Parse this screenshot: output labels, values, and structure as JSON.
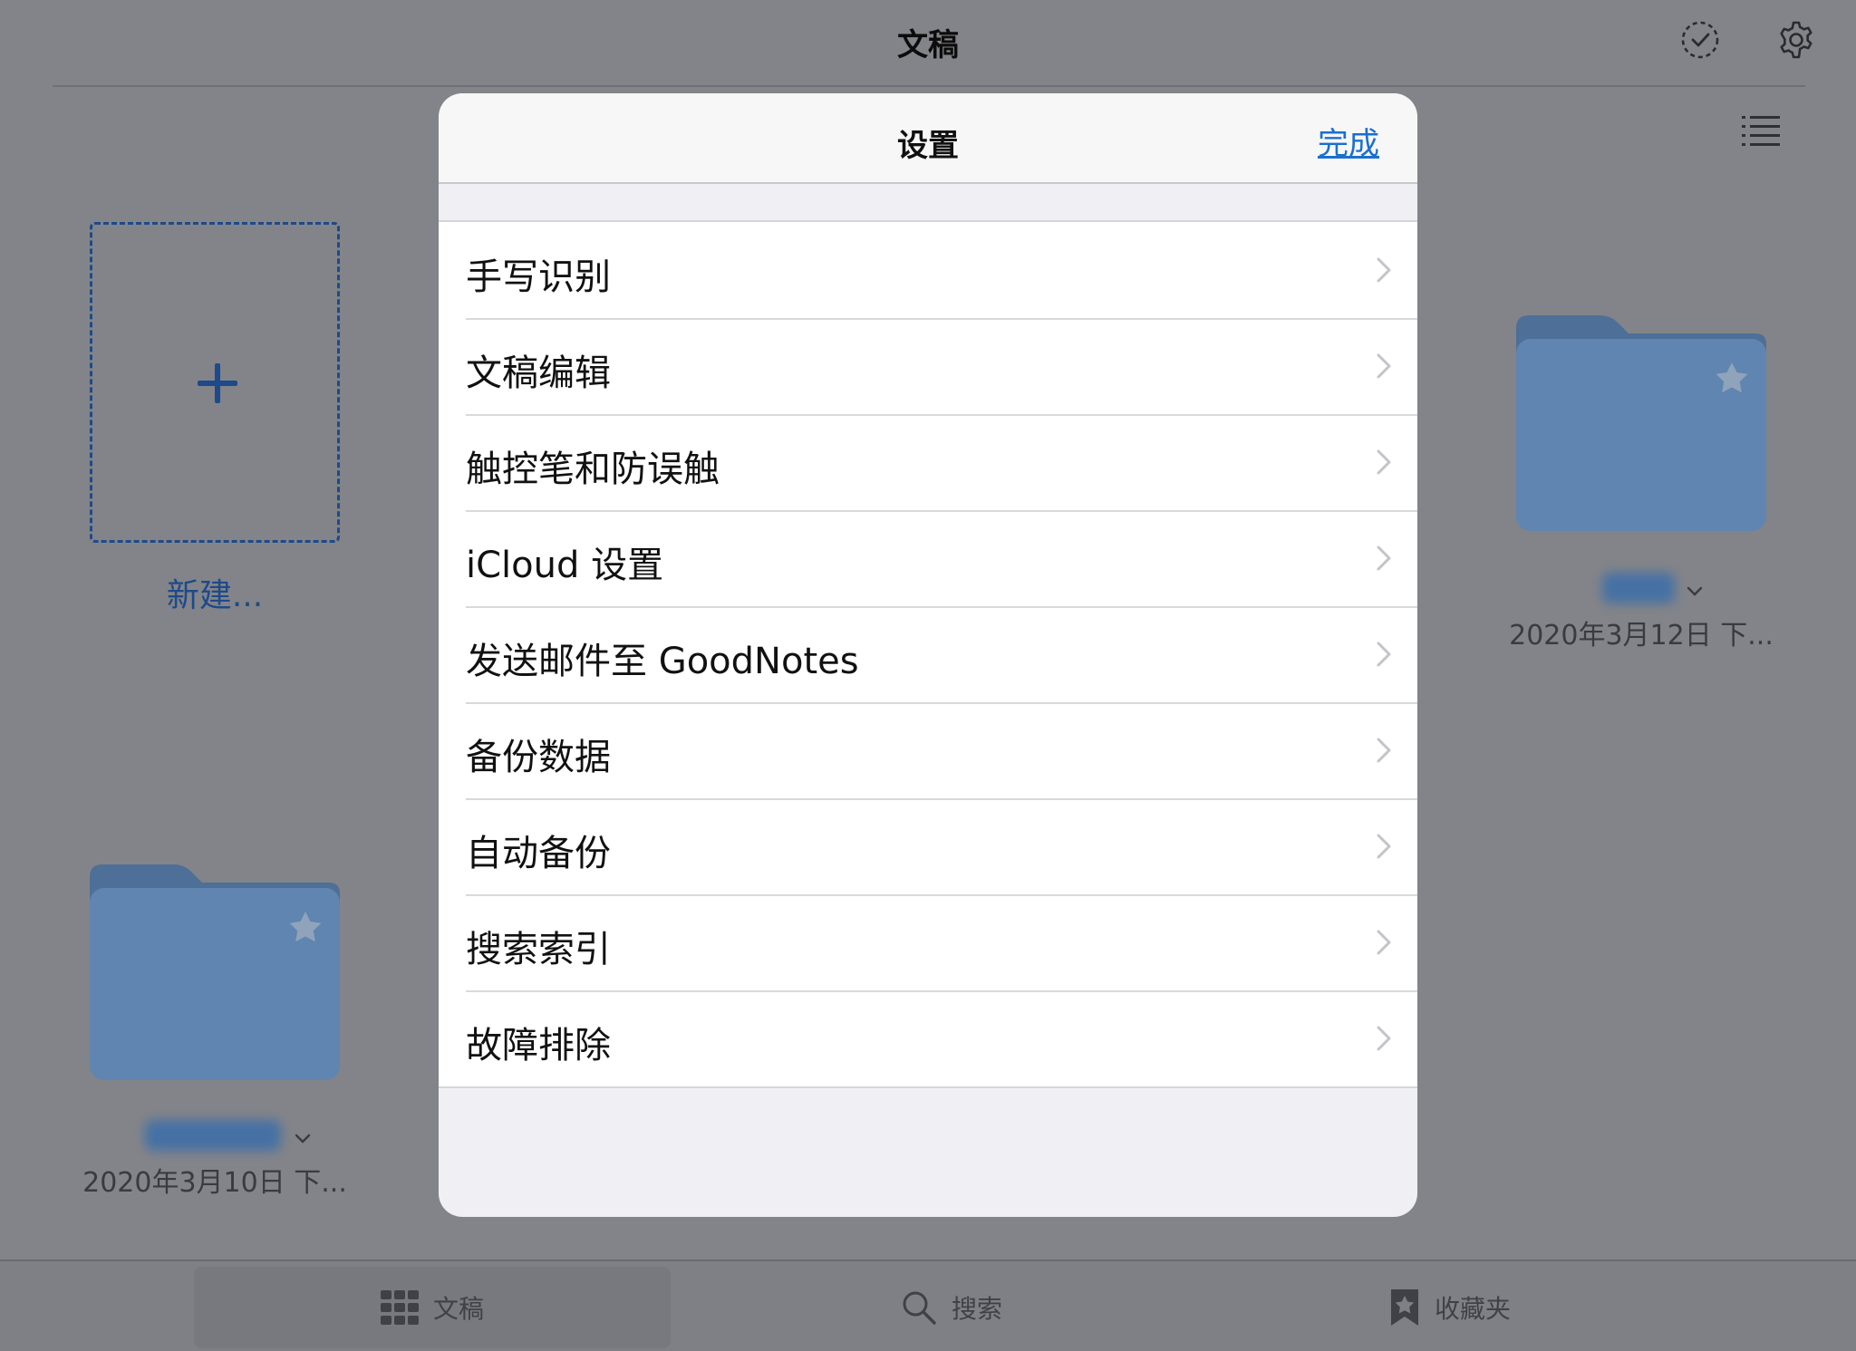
{
  "app": {
    "title": "文稿"
  },
  "toolbar": {
    "select_icon": "checkmark-circle-dashed-icon",
    "settings_icon": "gear-icon",
    "view_icon": "list-view-icon"
  },
  "grid": {
    "new_label": "新建...",
    "folders": [
      {
        "date": "2020年3月12日 下...",
        "icon": "folder-icon",
        "starred": false
      },
      {
        "date": "2020年3月10日 下...",
        "icon": "folder-icon",
        "starred": false
      }
    ]
  },
  "tabbar": {
    "tabs": [
      {
        "label": "文稿",
        "icon": "grid-icon",
        "selected": true
      },
      {
        "label": "搜索",
        "icon": "search-icon",
        "selected": false
      },
      {
        "label": "收藏夹",
        "icon": "bookmark-star-icon",
        "selected": false
      }
    ]
  },
  "modal": {
    "title": "设置",
    "done_label": "完成",
    "items": [
      {
        "label": "手写识别"
      },
      {
        "label": "文稿编辑"
      },
      {
        "label": "触控笔和防误触"
      },
      {
        "label": "iCloud 设置"
      },
      {
        "label": "发送邮件至 GoodNotes"
      },
      {
        "label": "备份数据"
      },
      {
        "label": "自动备份"
      },
      {
        "label": "搜索索引"
      },
      {
        "label": "故障排除"
      }
    ]
  },
  "colors": {
    "accent": "#1a6fd0",
    "dim_background": "#838489",
    "folder": "#5a7ea6"
  }
}
